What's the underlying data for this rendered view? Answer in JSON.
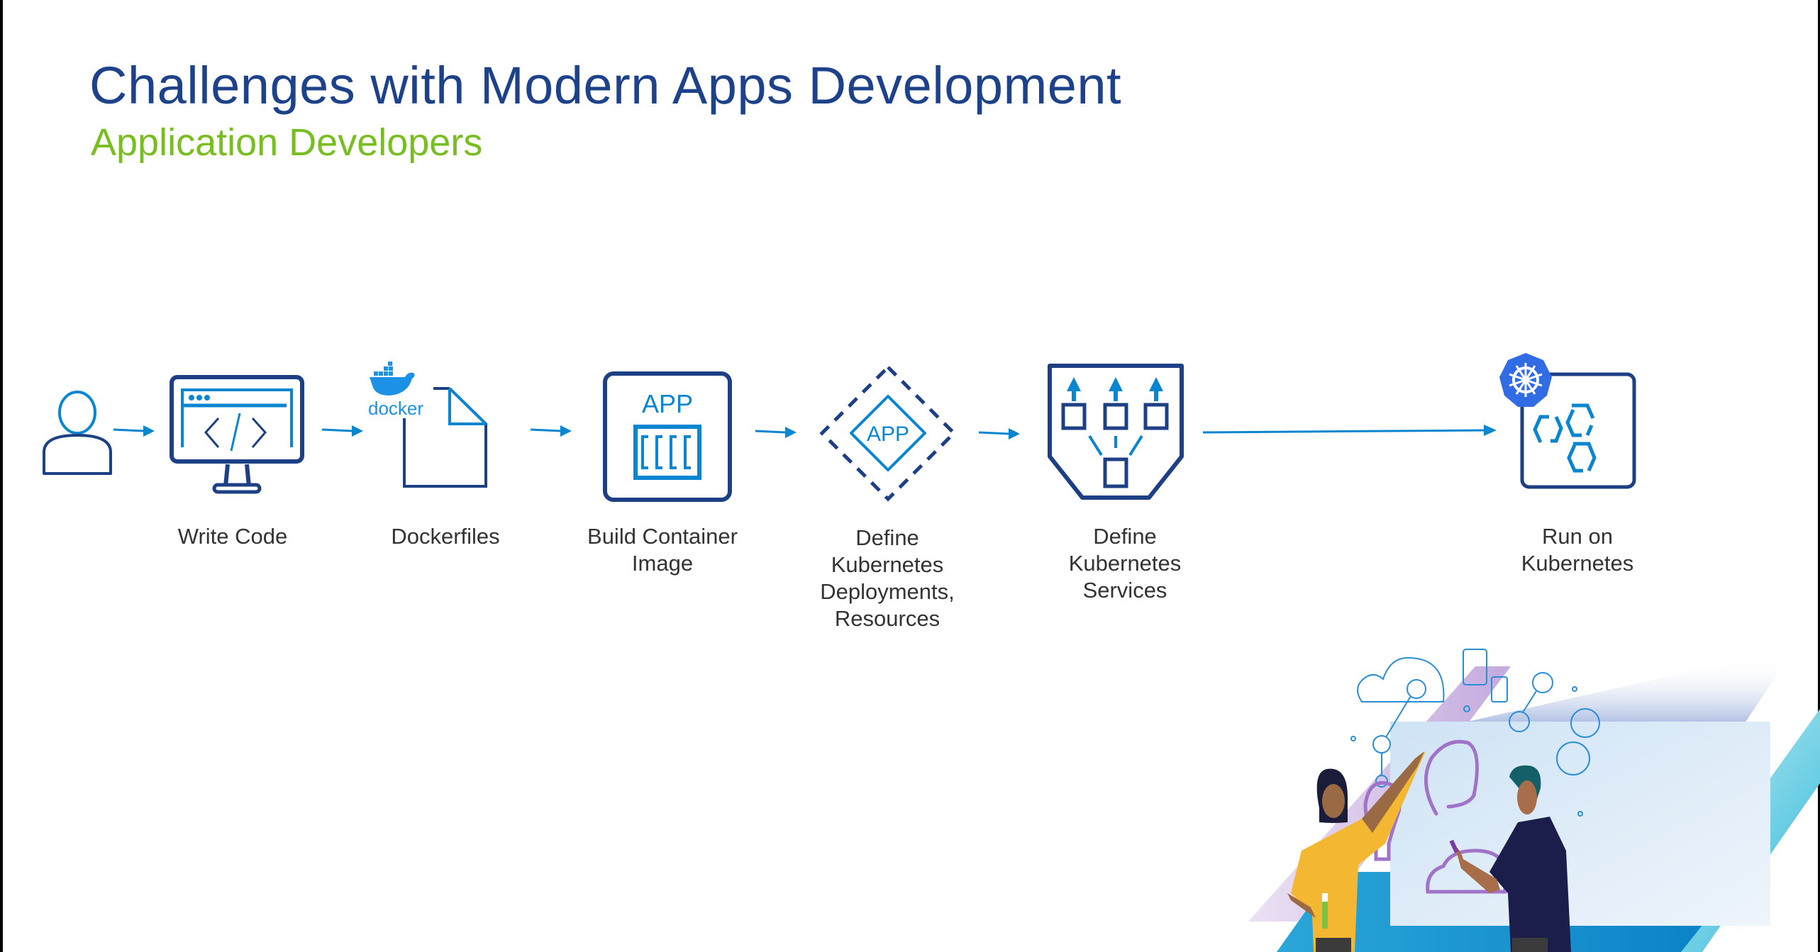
{
  "slide": {
    "title": "Challenges with Modern Apps Development",
    "subtitle": "Application Developers"
  },
  "colors": {
    "title": "#1d428a",
    "subtitle": "#78be20",
    "icon_dark": "#1d3f83",
    "icon_light": "#0a86d1",
    "kubernetes": "#326ce5",
    "docker": "#1d91e6",
    "label": "#333333"
  },
  "flow": {
    "actor_icon": "user-icon",
    "steps": [
      {
        "id": "write-code",
        "icon": "monitor-code-icon",
        "label": "Write Code"
      },
      {
        "id": "dockerfiles",
        "icon": "docker-file-icon",
        "label": "Dockerfiles",
        "logo_text": "docker"
      },
      {
        "id": "build-container-image",
        "icon": "app-container-icon",
        "label": "Build Container\nImage",
        "icon_text": "APP"
      },
      {
        "id": "define-deployments",
        "icon": "app-diamond-icon",
        "label": "Define\nKubernetes\nDeployments,\nResources",
        "icon_text": "APP"
      },
      {
        "id": "define-services",
        "icon": "services-shield-icon",
        "label": "Define\nKubernetes\nServices"
      },
      {
        "id": "run-on-kubernetes",
        "icon": "kubernetes-cluster-icon",
        "label": "Run on\nKubernetes"
      }
    ]
  },
  "illustration": {
    "description": "two-people-at-whiteboard-illustration"
  }
}
